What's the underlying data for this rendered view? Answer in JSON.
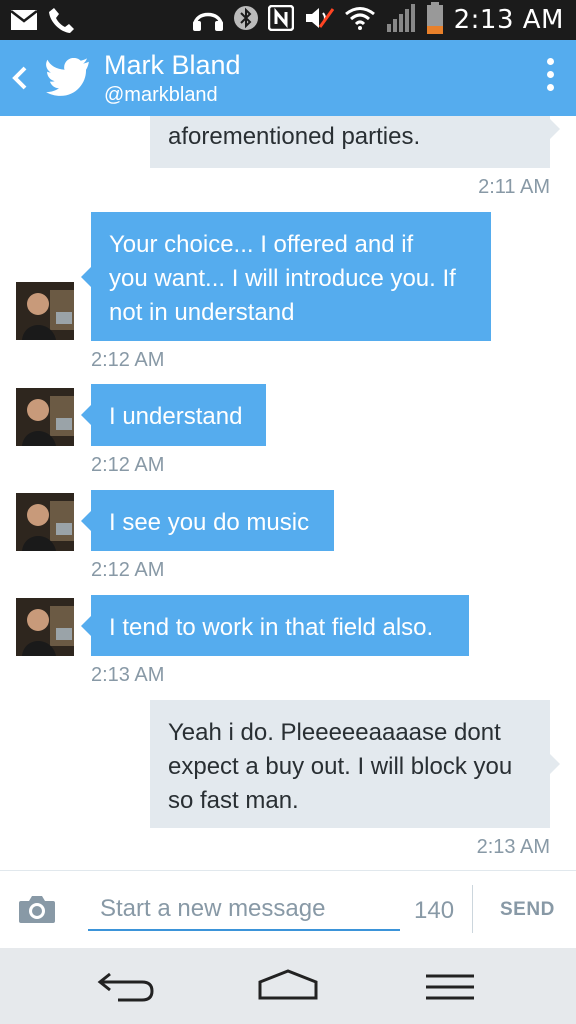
{
  "status_bar": {
    "time": "2:13 AM",
    "icons": [
      "mail-icon",
      "phone-icon",
      "headphones-icon",
      "bluetooth-icon",
      "nfc-icon",
      "mute-icon",
      "wifi-icon",
      "signal-icon",
      "battery-icon"
    ]
  },
  "header": {
    "name": "Mark Bland",
    "handle": "@markbland",
    "back_icon": "chevron-left-icon",
    "logo_icon": "twitter-bird-icon",
    "menu_icon": "overflow-menu-icon"
  },
  "messages": [
    {
      "direction": "out",
      "lines": [
        "aforementioned parties."
      ],
      "time": "2:11 AM"
    },
    {
      "direction": "in",
      "lines": [
        "Your choice... I offered and if",
        "you want... I will introduce you. If",
        "not in understand"
      ],
      "time": "2:12 AM"
    },
    {
      "direction": "in",
      "lines": [
        "I understand"
      ],
      "time": "2:12 AM"
    },
    {
      "direction": "in",
      "lines": [
        "I see you do music"
      ],
      "time": "2:12 AM"
    },
    {
      "direction": "in",
      "lines": [
        "I tend to work in that field also."
      ],
      "time": "2:13 AM"
    },
    {
      "direction": "out",
      "lines": [
        "Yeah i do. Pleeeeeaaaase dont",
        "expect a buy out. I will block you",
        "so fast man."
      ],
      "time": "2:13 AM"
    }
  ],
  "compose": {
    "placeholder": "Start a new message",
    "char_count": "140",
    "send_label": "SEND",
    "camera_icon": "camera-icon"
  },
  "navbar": {
    "icons": [
      "nav-back-icon",
      "nav-home-icon",
      "nav-menu-icon"
    ]
  },
  "colors": {
    "accent": "#55acee",
    "incoming_bubble": "#55acee",
    "outgoing_bubble": "#e3e9ee",
    "timestamp": "#8899a6",
    "status_bar": "#1b1b1b",
    "navbar": "#e6e9ec"
  }
}
